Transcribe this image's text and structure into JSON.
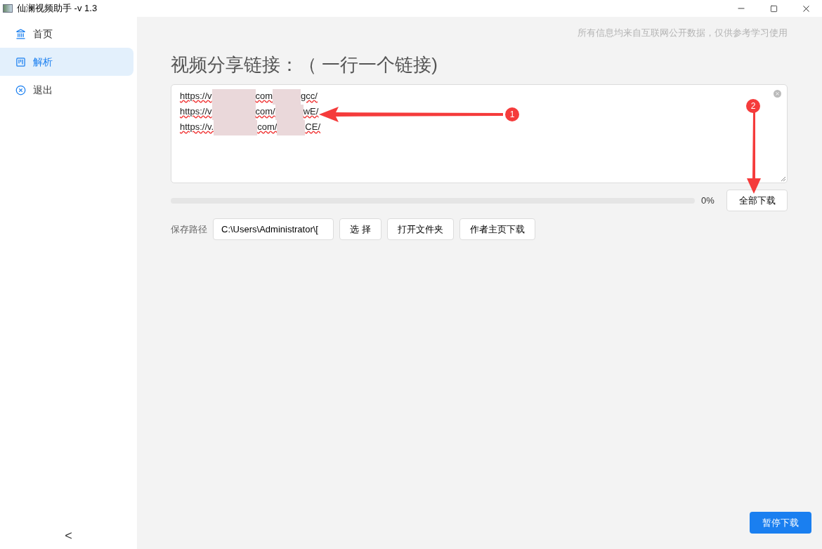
{
  "window": {
    "title": "仙澜视频助手 -v 1.3"
  },
  "sidebar": {
    "items": [
      {
        "label": "首页",
        "selected": false
      },
      {
        "label": "解析",
        "selected": true
      },
      {
        "label": "退出",
        "selected": false
      }
    ],
    "collapse": "<"
  },
  "notice": "所有信息均来自互联网公开数据，仅供参考学习使用",
  "heading": "视频分享链接：（ 一行一个链接)",
  "links": [
    [
      "https://v",
      "com",
      "gcc/"
    ],
    [
      "https://v",
      "com/",
      "wE/"
    ],
    [
      "https://v.",
      "com/",
      "CE/"
    ]
  ],
  "progress": {
    "level": 0,
    "reading": "0%"
  },
  "download_all": "全部下载",
  "save_path": {
    "label": "保存路径",
    "value": "C:\\Users\\Administrator\\[",
    "buttons": [
      "选 择",
      "打开文件夹",
      "作者主页下载"
    ]
  },
  "pause_button": "暂停下载",
  "annotations": [
    {
      "label": "1"
    },
    {
      "label": "2"
    }
  ]
}
